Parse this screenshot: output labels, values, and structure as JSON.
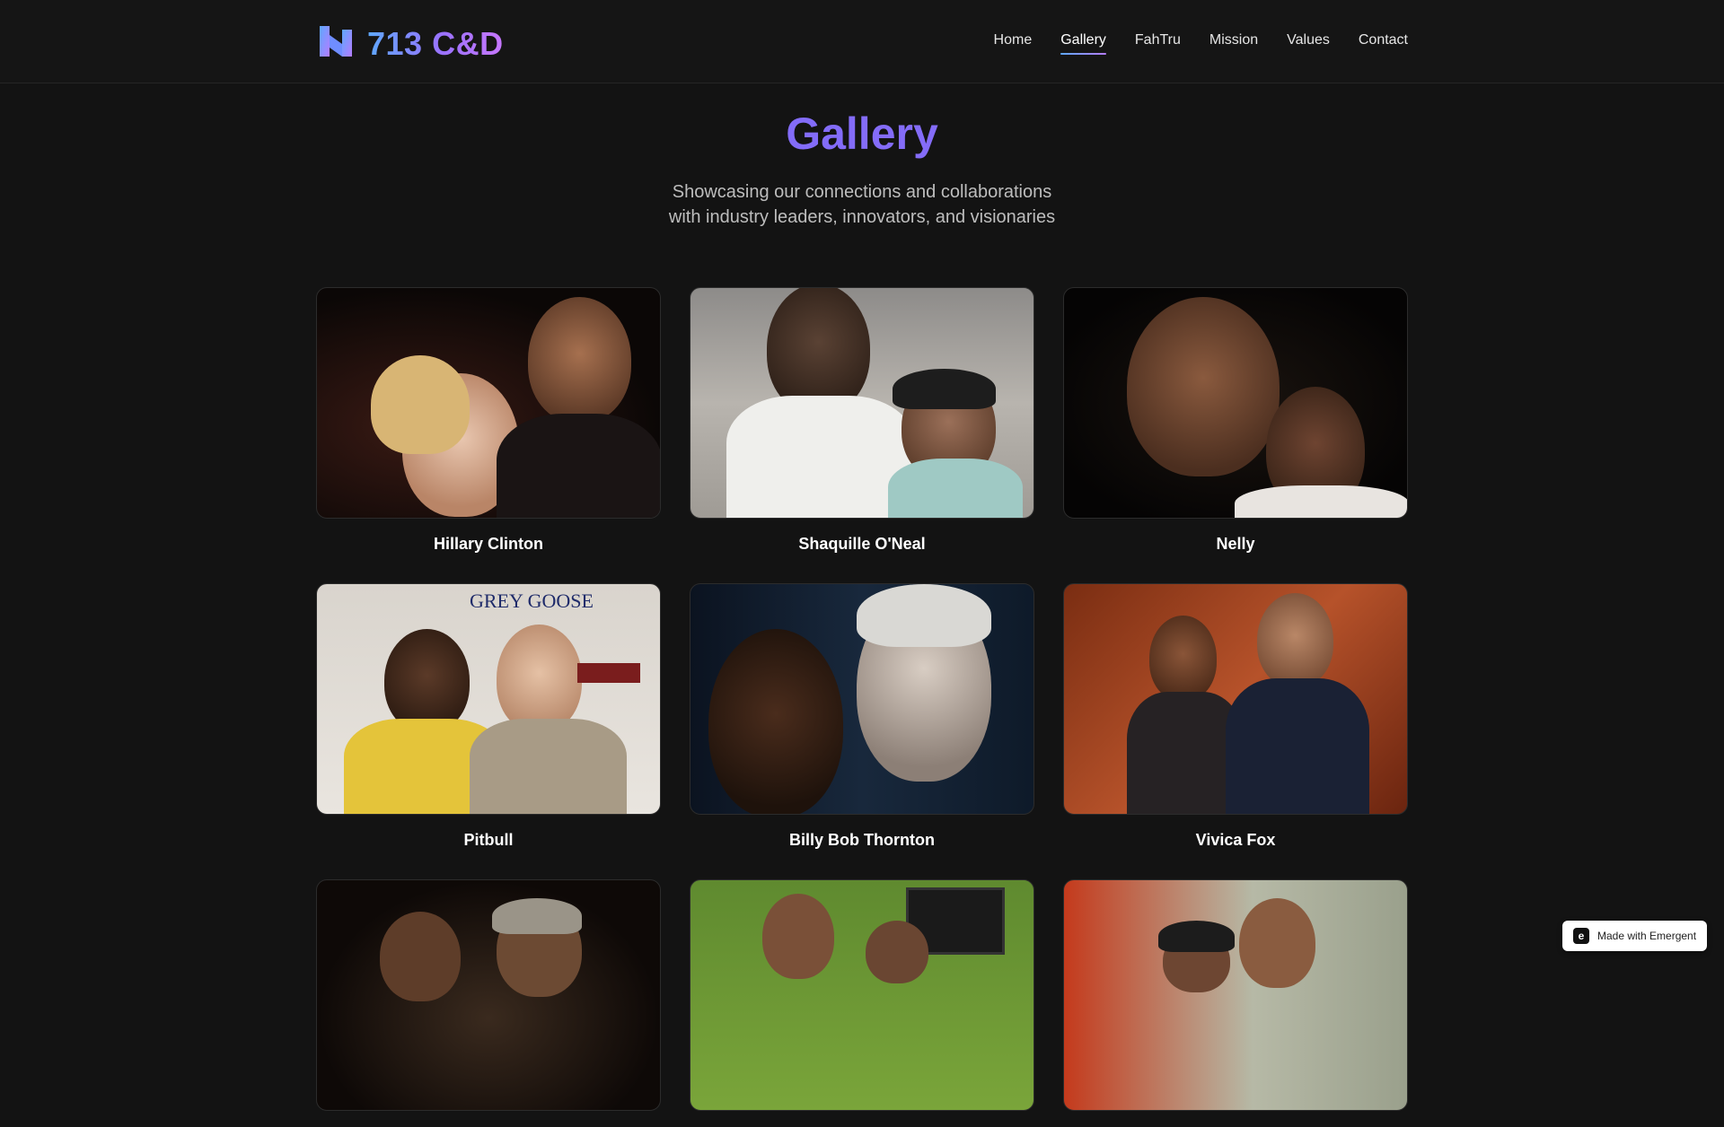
{
  "brand": {
    "name": "713 C&D",
    "logo_icon": "m-logo-icon"
  },
  "nav": {
    "items": [
      {
        "label": "Home",
        "active": false
      },
      {
        "label": "Gallery",
        "active": true
      },
      {
        "label": "FahTru",
        "active": false
      },
      {
        "label": "Mission",
        "active": false
      },
      {
        "label": "Values",
        "active": false
      },
      {
        "label": "Contact",
        "active": false
      }
    ]
  },
  "hero": {
    "title": "Gallery",
    "subtitle_line1": "Showcasing our connections and collaborations",
    "subtitle_line2": "with industry leaders, innovators, and visionaries"
  },
  "gallery": [
    {
      "name": "Hillary Clinton"
    },
    {
      "name": "Shaquille O'Neal"
    },
    {
      "name": "Nelly"
    },
    {
      "name": "Pitbull"
    },
    {
      "name": "Billy Bob Thornton"
    },
    {
      "name": "Vivica Fox"
    },
    {
      "name": ""
    },
    {
      "name": ""
    },
    {
      "name": ""
    }
  ],
  "badge": {
    "label": "Made with Emergent",
    "icon": "emergent-icon"
  },
  "colors": {
    "accent": "#8a6cf2",
    "logo_gradient_start": "#5ea8ff",
    "logo_gradient_end": "#c777ff",
    "background": "#131313"
  }
}
